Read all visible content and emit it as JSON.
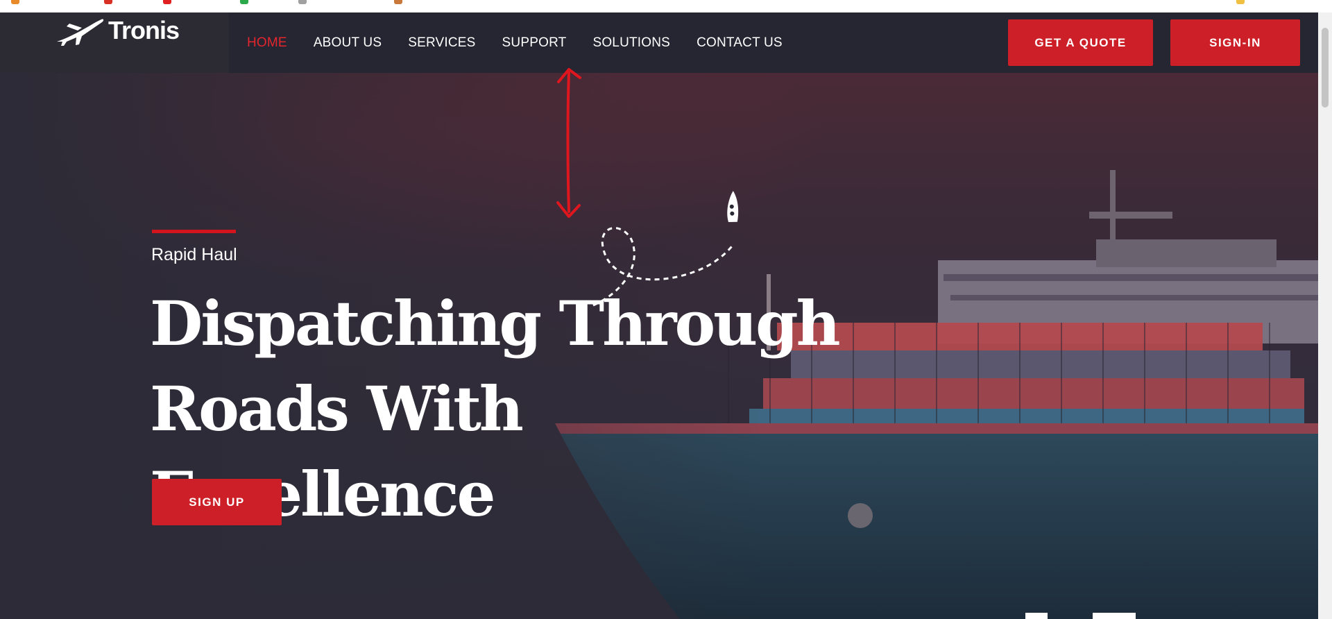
{
  "brand": {
    "name": "Tronis",
    "logo_icon": "airplane-icon",
    "accent_color": "#cc1f27",
    "active_color": "#e3262e"
  },
  "nav": {
    "items": [
      {
        "label": "HOME",
        "active": true
      },
      {
        "label": "ABOUT US",
        "active": false
      },
      {
        "label": "SERVICES",
        "active": false
      },
      {
        "label": "SUPPORT",
        "active": false
      },
      {
        "label": "SOLUTIONS",
        "active": false
      },
      {
        "label": "CONTACT US",
        "active": false
      }
    ]
  },
  "header_buttons": {
    "quote_label": "GET A QUOTE",
    "signin_label": "SIGN-IN"
  },
  "hero": {
    "eyebrow": "Rapid Haul",
    "headline_line1": "Dispatching Through",
    "headline_line2": "Roads With Excellence",
    "cta_label": "SIGN UP",
    "background_subject": "container-ship-icon"
  },
  "annotations": {
    "arrow": "double-headed-arrow-icon"
  }
}
